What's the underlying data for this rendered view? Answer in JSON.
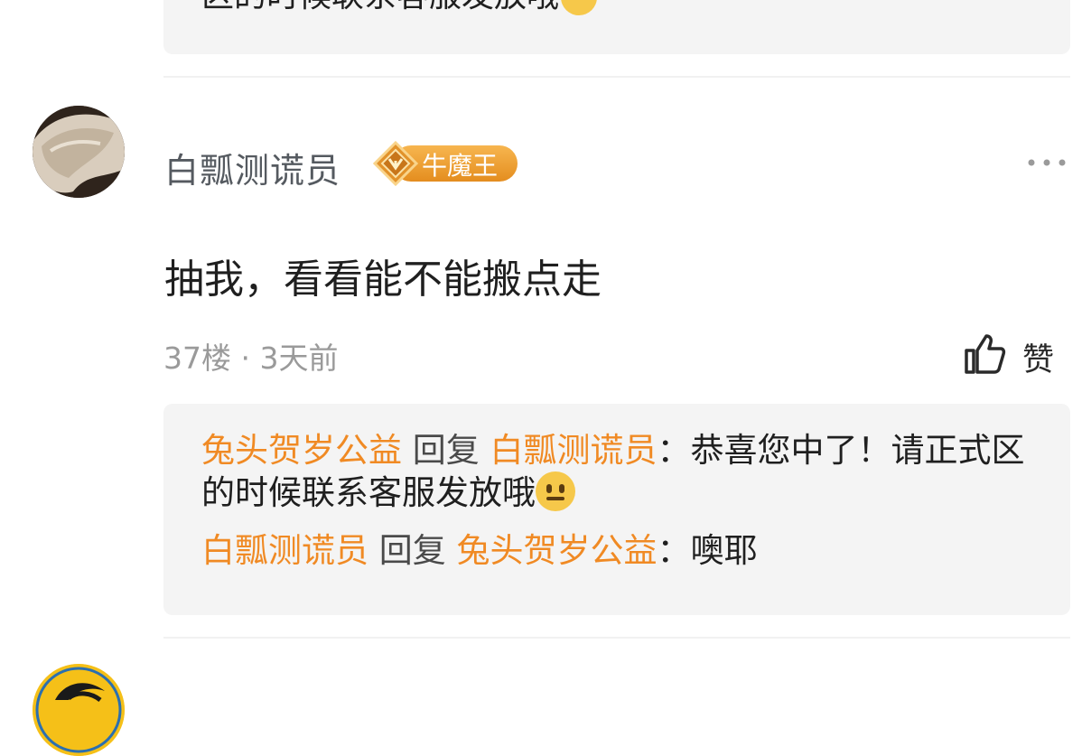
{
  "top_reply": {
    "partial_text": "区的时候联系客服发放哦"
  },
  "comment": {
    "username": "白瓢测谎员",
    "badge_label": "牛魔王",
    "text": "抽我，看看能不能搬点走",
    "floor": "37楼",
    "separator": "·",
    "time": "3天前",
    "like_label": "赞"
  },
  "replies": [
    {
      "from": "兔头贺岁公益",
      "verb": "回复",
      "to": "白瓢测谎员",
      "colon": "：",
      "text": "恭喜您中了！请正式区的时候联系客服发放哦",
      "emoji": "neutral-face-emoji"
    },
    {
      "from": "白瓢测谎员",
      "verb": "回复",
      "to": "兔头贺岁公益",
      "colon": "：",
      "text": "噢耶"
    }
  ],
  "colors": {
    "accent_orange": "#f08a24",
    "badge_gradient_top": "#f7b64f",
    "badge_gradient_bottom": "#e48d1f",
    "reply_bg": "#f4f4f4",
    "meta_gray": "#9a9a9a"
  }
}
